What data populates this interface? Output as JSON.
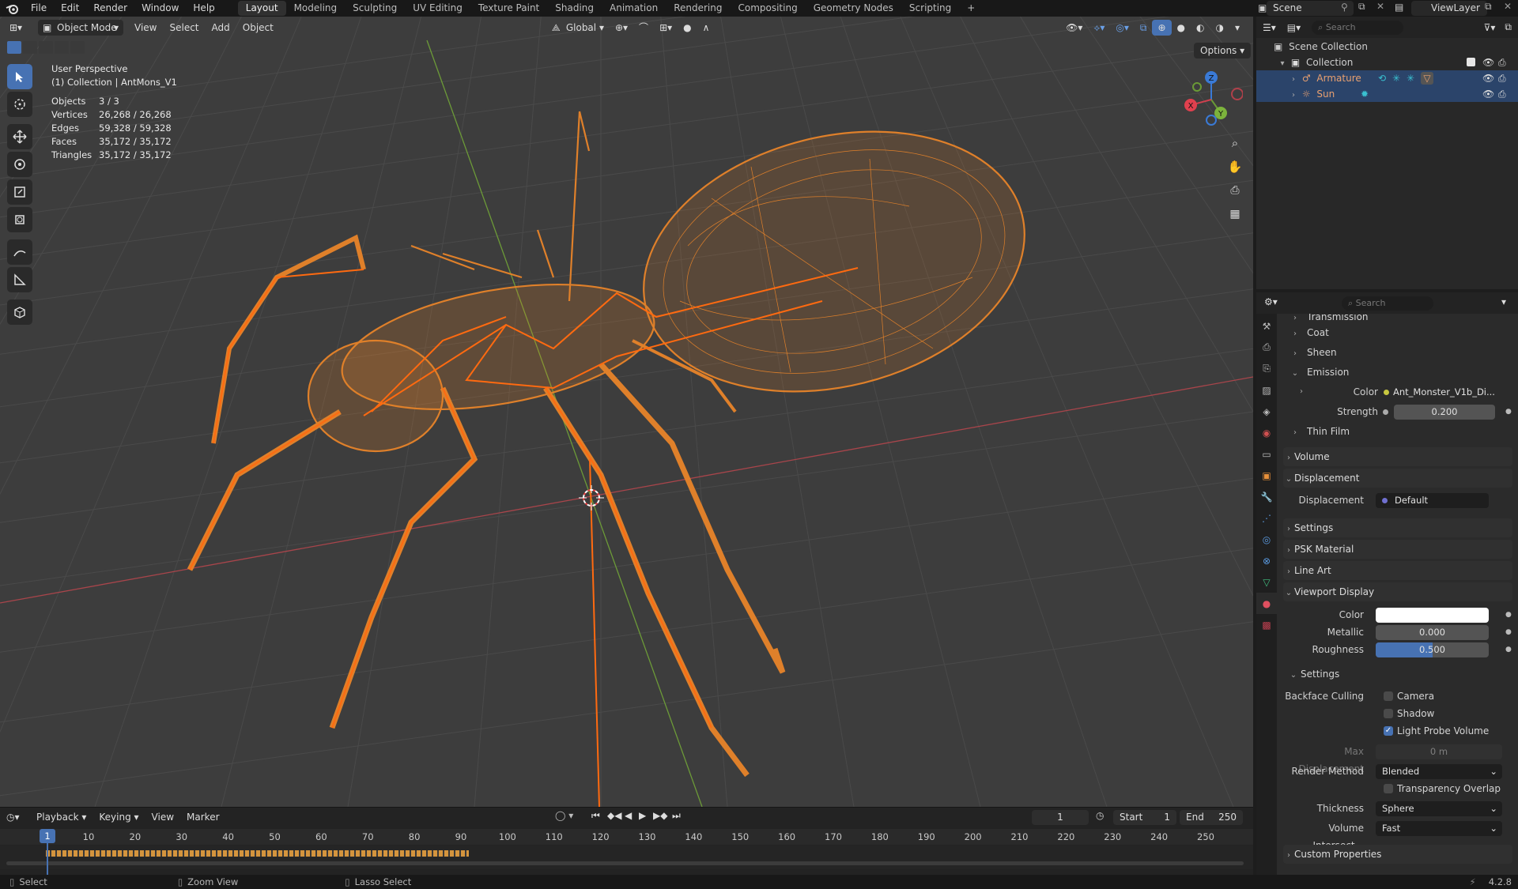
{
  "topbar": {
    "menus": [
      "File",
      "Edit",
      "Render",
      "Window",
      "Help"
    ],
    "workspaces": [
      "Layout",
      "Modeling",
      "Sculpting",
      "UV Editing",
      "Texture Paint",
      "Shading",
      "Animation",
      "Rendering",
      "Compositing",
      "Geometry Nodes",
      "Scripting"
    ],
    "active_workspace": "Layout",
    "add_workspace": "+",
    "scene": "Scene",
    "view_layer": "ViewLayer"
  },
  "viewport": {
    "mode": "Object Mode",
    "menus": [
      "View",
      "Select",
      "Add",
      "Object"
    ],
    "transform_orientation": "Global",
    "options": "Options",
    "perspective_label": "User Perspective",
    "collection_label": "(1) Collection | AntMons_V1",
    "stats": [
      {
        "k": "Objects",
        "v": "3 / 3"
      },
      {
        "k": "Vertices",
        "v": "26,268 / 26,268"
      },
      {
        "k": "Edges",
        "v": "59,328 / 59,328"
      },
      {
        "k": "Faces",
        "v": "35,172 / 35,172"
      },
      {
        "k": "Triangles",
        "v": "35,172 / 35,172"
      }
    ],
    "gizmo_axes": {
      "z": "Z",
      "y": "Y",
      "x": "X"
    },
    "colors": {
      "wire": "#e8842a",
      "bone": "#ff6a10",
      "grid": "#4a4a4a",
      "x_axis": "#b0454a",
      "y_axis": "#6a9a36"
    }
  },
  "timeline": {
    "menus": [
      "Playback",
      "Keying",
      "View",
      "Marker"
    ],
    "current_frame": "1",
    "start_label": "Start",
    "start": "1",
    "end_label": "End",
    "end": "250",
    "ticks": [
      "1",
      "10",
      "20",
      "30",
      "40",
      "50",
      "60",
      "70",
      "80",
      "90",
      "100",
      "110",
      "120",
      "130",
      "140",
      "150",
      "160",
      "170",
      "180",
      "190",
      "200",
      "210",
      "220",
      "230",
      "240",
      "250"
    ]
  },
  "status": {
    "select": "Select",
    "zoom": "Zoom View",
    "lasso": "Lasso Select",
    "version": "4.2.8"
  },
  "outliner": {
    "search_placeholder": "Search",
    "items": [
      {
        "label": "Scene Collection",
        "level": 0
      },
      {
        "label": "Collection",
        "level": 1
      },
      {
        "label": "Armature",
        "level": 2
      },
      {
        "label": "Sun",
        "level": 2
      }
    ]
  },
  "properties": {
    "search_placeholder": "Search",
    "sections": {
      "transmission": "Transmission",
      "coat": "Coat",
      "sheen": "Sheen",
      "emission": "Emission",
      "color_label": "Color",
      "color_value": "Ant_Monster_V1b_Di...",
      "strength_label": "Strength",
      "strength_value": "0.200",
      "thin_film": "Thin Film",
      "volume": "Volume",
      "displacement": "Displacement",
      "displacement_label": "Displacement",
      "displacement_value": "Default",
      "settings": "Settings",
      "psk": "PSK Material",
      "line_art": "Line Art",
      "viewport_display": "Viewport Display",
      "vd_color": "Color",
      "metallic_label": "Metallic",
      "metallic_value": "0.000",
      "roughness_label": "Roughness",
      "roughness_value": "0.500",
      "roughness_fraction": 0.5,
      "vd_settings": "Settings",
      "backface_culling": "Backface Culling",
      "camera": "Camera",
      "shadow": "Shadow",
      "light_probe": "Light Probe Volume",
      "max_disp_label": "Max Displacement",
      "max_disp_value": "0 m",
      "render_method_label": "Render Method",
      "render_method_value": "Blended",
      "transparency_overlap": "Transparency Overlap",
      "thickness_label": "Thickness",
      "thickness_value": "Sphere",
      "vol_intersect_label": "Volume Intersect...",
      "vol_intersect_value": "Fast",
      "custom_properties": "Custom Properties"
    },
    "checks": {
      "camera": false,
      "shadow": false,
      "light_probe": true,
      "transparency_overlap": false
    }
  }
}
